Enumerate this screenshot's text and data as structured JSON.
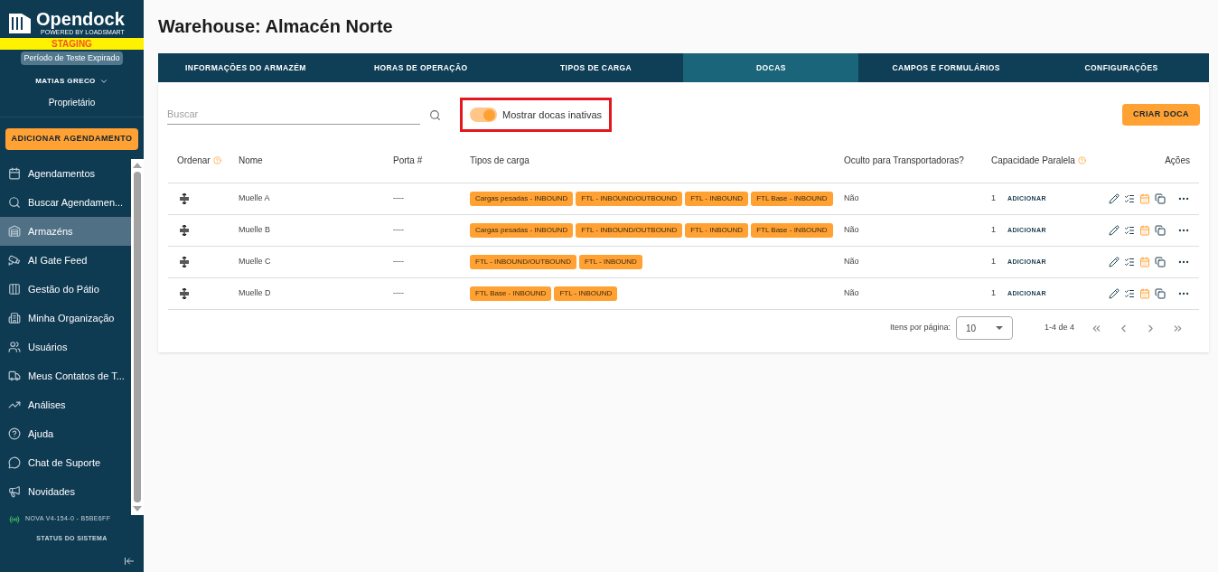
{
  "sidebar": {
    "logo": "Opendock",
    "logo_sub": "POWERED BY LOADSMART",
    "env_badge": "STAGING",
    "trial_badge": "Período de Teste Expirado",
    "user": {
      "name": "MATIAS GRECO",
      "role": "Proprietário"
    },
    "add_button": "ADICIONAR AGENDAMENTO",
    "items": [
      {
        "label": "Agendamentos",
        "selected": false
      },
      {
        "label": "Buscar Agendamen...",
        "selected": false
      },
      {
        "label": "Armazéns",
        "selected": true
      },
      {
        "label": "AI Gate Feed",
        "selected": false
      },
      {
        "label": "Gestão do Pátio",
        "selected": false
      },
      {
        "label": "Minha Organização",
        "selected": false
      },
      {
        "label": "Usuários",
        "selected": false
      },
      {
        "label": "Meus Contatos de T...",
        "selected": false
      },
      {
        "label": "Análises",
        "selected": false
      },
      {
        "label": "Ajuda",
        "selected": false
      },
      {
        "label": "Chat de Suporte",
        "selected": false
      },
      {
        "label": "Novidades",
        "selected": false
      }
    ],
    "version": "NOVA V4-154-0 - B5BE6FF",
    "status": "STATUS DO SISTEMA"
  },
  "title": "Warehouse: Almacén Norte",
  "tabs": [
    {
      "label": "INFORMAÇÕES DO ARMAZÉM",
      "selected": false
    },
    {
      "label": "HORAS DE OPERAÇÃO",
      "selected": false
    },
    {
      "label": "TIPOS DE CARGA",
      "selected": false
    },
    {
      "label": "DOCAS",
      "selected": true
    },
    {
      "label": "CAMPOS E FORMULÁRIOS",
      "selected": false
    },
    {
      "label": "CONFIGURAÇÕES",
      "selected": false
    }
  ],
  "search": {
    "placeholder": "Buscar"
  },
  "toggle": {
    "label": "Mostrar docas inativas",
    "on": true
  },
  "create_button": "CRIAR DOCA",
  "table": {
    "columns": [
      "Ordenar",
      "Nome",
      "Porta #",
      "Tipos de carga",
      "Oculto para Transportadoras?",
      "Capacidade Paralela",
      "Ações"
    ],
    "rows": [
      {
        "name": "Muelle A",
        "door": "----",
        "load_types": [
          "Cargas pesadas - INBOUND",
          "FTL - INBOUND/OUTBOUND",
          "FTL - INBOUND",
          "FTL Base - INBOUND"
        ],
        "hidden": "Não",
        "capacity": "1",
        "add": "ADICIONAR"
      },
      {
        "name": "Muelle B",
        "door": "----",
        "load_types": [
          "Cargas pesadas - INBOUND",
          "FTL - INBOUND/OUTBOUND",
          "FTL - INBOUND",
          "FTL Base - INBOUND"
        ],
        "hidden": "Não",
        "capacity": "1",
        "add": "ADICIONAR"
      },
      {
        "name": "Muelle C",
        "door": "----",
        "load_types": [
          "FTL - INBOUND/OUTBOUND",
          "FTL - INBOUND"
        ],
        "hidden": "Não",
        "capacity": "1",
        "add": "ADICIONAR"
      },
      {
        "name": "Muelle D",
        "door": "----",
        "load_types": [
          "FTL Base - INBOUND",
          "FTL - INBOUND"
        ],
        "hidden": "Não",
        "capacity": "1",
        "add": "ADICIONAR"
      }
    ]
  },
  "pagination": {
    "label": "Itens por página:",
    "per_page": "10",
    "range": "1-4 de 4"
  }
}
